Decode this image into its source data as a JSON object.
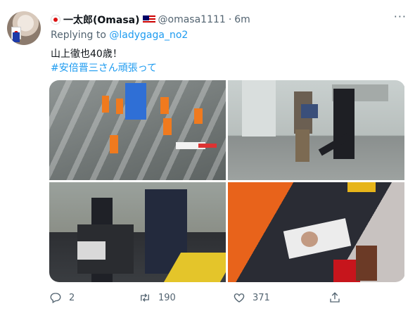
{
  "tweet": {
    "author_name": "一太郎(Omasa)",
    "handle": "@omasa1111",
    "separator": "·",
    "time": "6m",
    "more": "···",
    "replying_prefix": "Replying to",
    "replying_to": "@ladygaga_no2",
    "text_line1": "山上徹也40歳！",
    "hashtag": "#安倍晋三さん頑張って"
  },
  "actions": {
    "reply_count": "2",
    "retweet_count": "190",
    "like_count": "371"
  },
  "icons": [
    "jp-flag-icon",
    "my-flag-icon",
    "reply-icon",
    "retweet-icon",
    "like-icon",
    "share-icon"
  ],
  "colors": {
    "link": "#1d9bf0",
    "secondary": "#536471",
    "text": "#0f1419"
  }
}
